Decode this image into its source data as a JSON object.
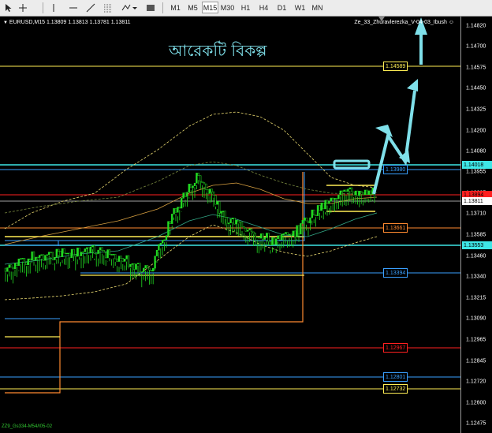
{
  "toolbar": {
    "timeframes": [
      "M1",
      "M5",
      "M15",
      "M30",
      "H1",
      "H4",
      "D1",
      "W1",
      "MN"
    ],
    "active_timeframe": "M15"
  },
  "chart": {
    "symbol_line": "EURUSD,M15  1.13809 1.13813 1.13781 1.13811",
    "ea_label": "Ze_33_Zhuravlerezka_V-04-03_Ibush",
    "overlay_title": "আরেকটি বিকল্প",
    "footer_tag": "ZZ9_Gs334-M54/I05-02",
    "colors": {
      "background": "#000000",
      "bull_candle": "#22dd22",
      "bear_candle": "#22dd22",
      "cyan_line": "#3ee6e6",
      "arrow": "#7fe0ea"
    }
  },
  "price_axis": {
    "ticks": [
      "1.14820",
      "1.14700",
      "1.14575",
      "1.14450",
      "1.14325",
      "1.14200",
      "1.14080",
      "1.13955",
      "1.13835",
      "1.13710",
      "1.13585",
      "1.13460",
      "1.13340",
      "1.13215",
      "1.13090",
      "1.12965",
      "1.12845",
      "1.12720",
      "1.12600",
      "1.12475"
    ],
    "tags": [
      {
        "text": "1.14018",
        "color": "#3ee6e6"
      },
      {
        "text": "1.13894",
        "color": "#ff2020"
      },
      {
        "text": "1.13811",
        "color": "#ffffff"
      },
      {
        "text": "1.13553",
        "color": "#3ee6e6"
      }
    ]
  },
  "levels": [
    {
      "label": "1.14589",
      "color": "#ffee55"
    },
    {
      "label": "1.13980",
      "color": "#3aa0ff"
    },
    {
      "label": "1.13661",
      "color": "#ff8a30"
    },
    {
      "label": "1.13394",
      "color": "#3aa0ff"
    },
    {
      "label": "1.12967",
      "color": "#ff2020"
    },
    {
      "label": "1.12801",
      "color": "#3aa0ff"
    },
    {
      "label": "1.12732",
      "color": "#ffee55"
    }
  ]
}
